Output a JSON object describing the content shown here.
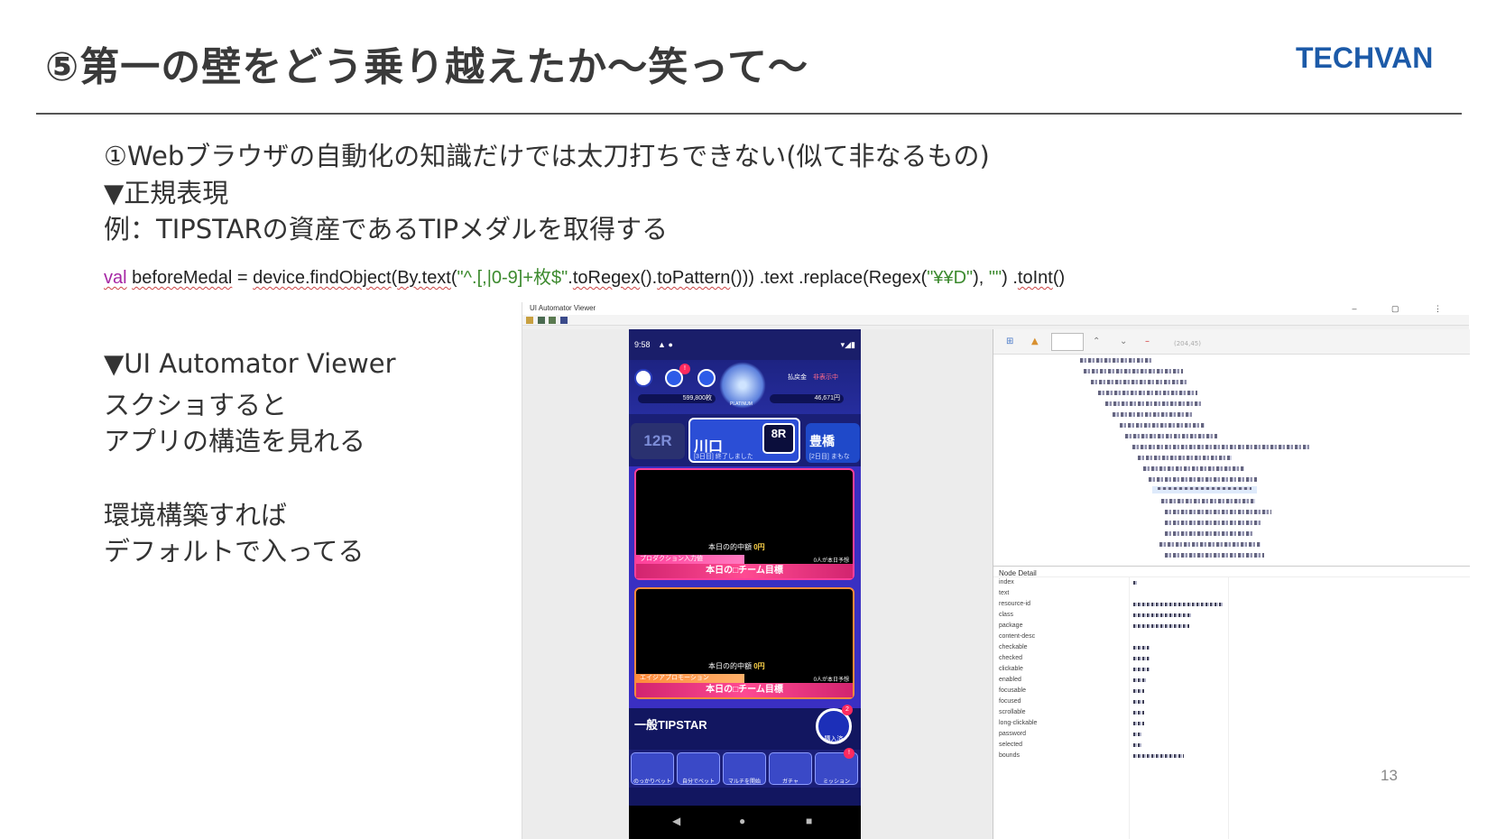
{
  "slide": {
    "title": "⑤第一の壁をどう乗り越えたか〜笑って〜",
    "logo": "TECHVAN",
    "page_number": "13"
  },
  "body": {
    "line1": "①Webブラウザの自動化の知識だけでは太刀打ちできない(似て非なるもの)",
    "line2": "▼正規表現",
    "line3": "例：TIPSTARの資産であるTIPメダルを取得する",
    "code": {
      "kw": "val",
      "var": "beforeMedal",
      "eq": " = ",
      "obj": "device.findObject",
      "paren": "(",
      "by": "By.text",
      "open": "(",
      "regex": "\"^.[,|0-9]+枚$\"",
      "dot": ".",
      "toregex": "toRegex",
      "p1": "().",
      "topattern": "toPattern",
      "rest": "())) .text .replace(Regex(",
      "regex2": "\"¥¥D\"",
      "comma": "), ",
      "empty": "\"\"",
      "rest2": ") .",
      "toint": "toInt",
      "tail": "()"
    },
    "viewer_head": "▼UI Automator Viewer",
    "viewer_l1": "スクショすると",
    "viewer_l2": "アプリの構造を見れる",
    "env_l1": "環境構築すれば",
    "env_l2": "デフォルトで入ってる"
  },
  "uav": {
    "window_title": "UI Automator Viewer",
    "window_controls": "– ▢ ⋮",
    "coord": "(204,45)",
    "node_detail_title": "Node Detail",
    "node_fields": [
      "index",
      "text",
      "resource-id",
      "class",
      "package",
      "content-desc",
      "checkable",
      "checked",
      "clickable",
      "enabled",
      "focusable",
      "focused",
      "scrollable",
      "long-clickable",
      "password",
      "selected",
      "bounds"
    ]
  },
  "phone": {
    "time": "9:58",
    "status_icons": "▲ ●",
    "signal": "▾◢▮",
    "balance_label": "払戻金",
    "balance_state": "非表示中",
    "coins": "599,800枚",
    "yen": "46,671円",
    "rank_label": "PLATINUM",
    "race_no": "12R",
    "city_main": "川口",
    "city_main_note": "[3日目] 終了しました",
    "race_btn": "8R",
    "city_side": "豊橋",
    "city_side_note": "[2日目] まもな",
    "cards": [
      {
        "hit": "本日の的中額",
        "amount": "0円",
        "tag": "プロダクション入力値",
        "pred": "0人が本日予想",
        "goal": "本日の□チーム目標"
      },
      {
        "hit": "本日の的中額",
        "amount": "0円",
        "tag": "エイジアプロモーション",
        "pred": "0人が本日予想",
        "goal": "本日の□チーム目標"
      }
    ],
    "tipstar": "一般TIPSTAR",
    "buy_label": "購入済",
    "buy_badge": "2",
    "nav": [
      "のっかりベット",
      "自分でベット",
      "マルチを開始",
      "ガチャ",
      "ミッション"
    ],
    "nav_badge": "!",
    "sysnav_back": "◀",
    "sysnav_home": "●",
    "sysnav_recent": "■",
    "header_badge": "!"
  }
}
